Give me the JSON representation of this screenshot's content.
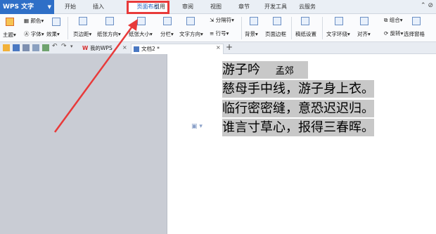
{
  "app": {
    "name": "WPS 文字"
  },
  "menu": [
    "开始",
    "插入",
    "页面布局",
    "引用",
    "审阅",
    "视图",
    "章节",
    "开发工具",
    "云服务"
  ],
  "ribbon": {
    "theme": "主题",
    "colors": "颜色",
    "fonts": "字体",
    "effects": "效果",
    "margins": "页边距",
    "orientation": "纸张方向",
    "size": "纸张大小",
    "columns": "分栏",
    "text_direction": "文字方向",
    "separator": "分隔符",
    "line_num": "行号",
    "background": "背景",
    "page_border": "页面边框",
    "paper_setup": "稿纸设置",
    "wrap": "文字环绕",
    "align": "对齐",
    "group": "组合",
    "rotate": "旋转",
    "selection_pane": "选择窗格"
  },
  "tabs": [
    {
      "label": "我的WPS"
    },
    {
      "label": "文档2 *"
    }
  ],
  "add_tab": "+",
  "poem": {
    "title": "游子吟",
    "author": "孟郊",
    "lines": [
      "慈母手中线，游子身上衣。",
      "临行密密缝，意恐迟迟归。",
      "谁言寸草心，报得三春晖。"
    ]
  },
  "colors": {
    "accent": "#2f6fc7",
    "annotation": "#e83a3a",
    "selection": "#c8c8c8"
  }
}
